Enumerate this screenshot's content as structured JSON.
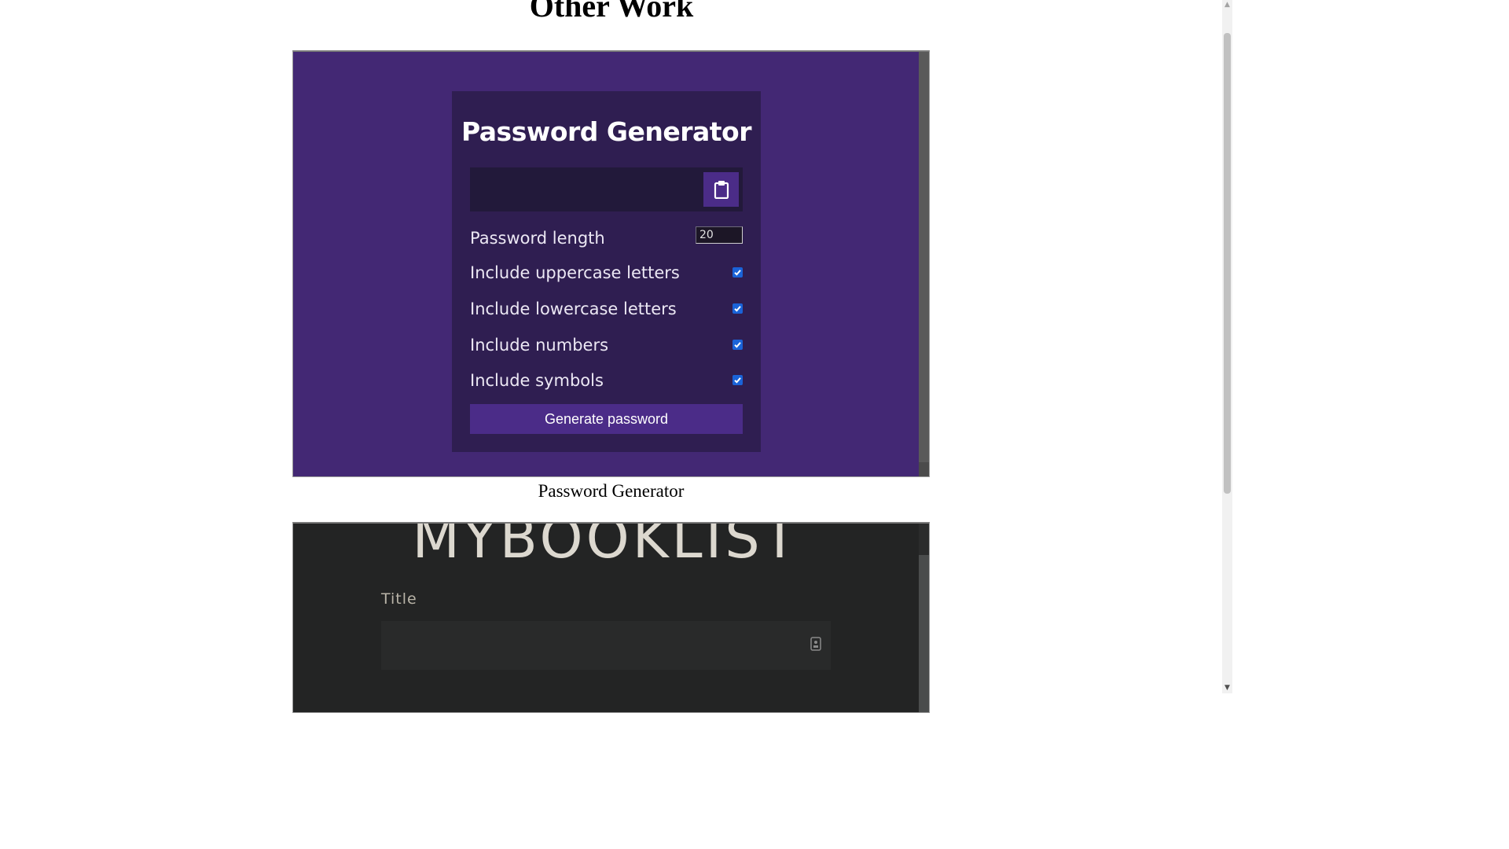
{
  "page": {
    "title": "Other Work"
  },
  "password_generator": {
    "title": "Password Generator",
    "result_value": "",
    "copy_icon": "clipboard-icon",
    "length": {
      "label": "Password length",
      "value": "20"
    },
    "options": [
      {
        "label": "Include uppercase letters",
        "checked": true
      },
      {
        "label": "Include lowercase letters",
        "checked": true
      },
      {
        "label": "Include numbers",
        "checked": true
      },
      {
        "label": "Include symbols",
        "checked": true
      }
    ],
    "generate_label": "Generate password",
    "caption": "Password Generator",
    "colors": {
      "background": "#432874",
      "card": "#2f1e51",
      "result": "#22193a",
      "accent": "#4b2c88",
      "checkbox": "#1a63d8"
    }
  },
  "booklist": {
    "title": "MYBOOKLIST",
    "field_label": "Title",
    "input_value": "",
    "input_icon": "contact-card-icon",
    "colors": {
      "background": "#232424",
      "text": "#dcd8cf"
    }
  }
}
